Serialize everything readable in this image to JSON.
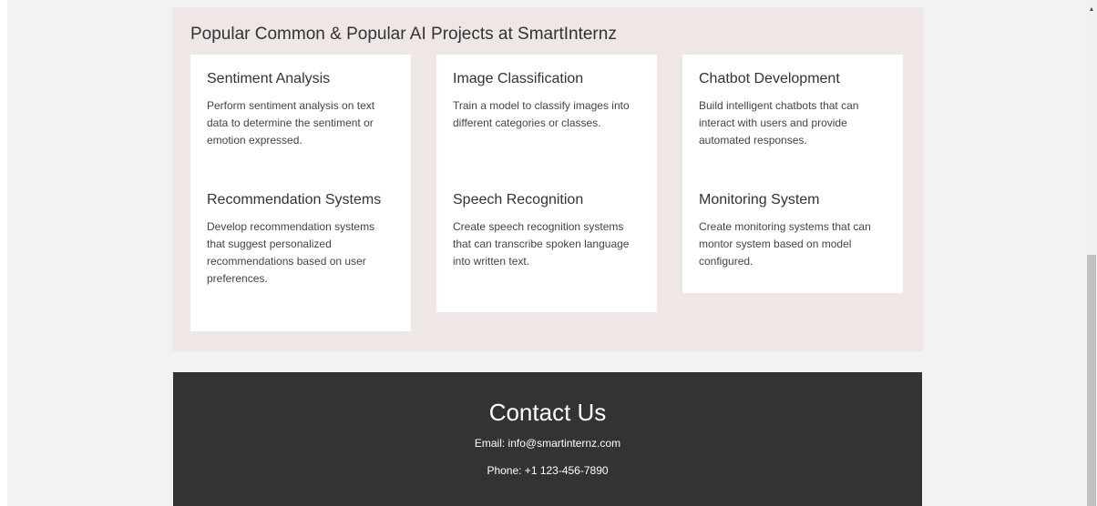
{
  "projects": {
    "title": "Popular Common & Popular AI Projects at SmartInternz",
    "cards": [
      {
        "title": "Sentiment Analysis",
        "description": "Perform sentiment analysis on text data to determine the sentiment or emotion expressed."
      },
      {
        "title": "Image Classification",
        "description": "Train a model to classify images into different categories or classes."
      },
      {
        "title": "Chatbot Development",
        "description": "Build intelligent chatbots that can interact with users and provide automated responses."
      },
      {
        "title": "Recommendation Systems",
        "description": "Develop recommendation systems that suggest personalized recommendations based on user preferences."
      },
      {
        "title": "Speech Recognition",
        "description": "Create speech recognition systems that can transcribe spoken language into written text."
      },
      {
        "title": "Monitoring System",
        "description": "Create monitoring systems that can montor system based on model configured."
      }
    ]
  },
  "contact": {
    "title": "Contact Us",
    "email": "Email: info@smartinternz.com",
    "phone": "Phone: +1 123-456-7890"
  },
  "scrollbar": {
    "up_arrow_icon": "scroll-up-arrow-icon",
    "up_arrow_glyph": "▲"
  },
  "colors": {
    "page_background": "#f2f2f2",
    "projects_background": "#efe6e6",
    "card_background": "#ffffff",
    "footer_background": "#333333",
    "footer_text": "#ffffff"
  }
}
